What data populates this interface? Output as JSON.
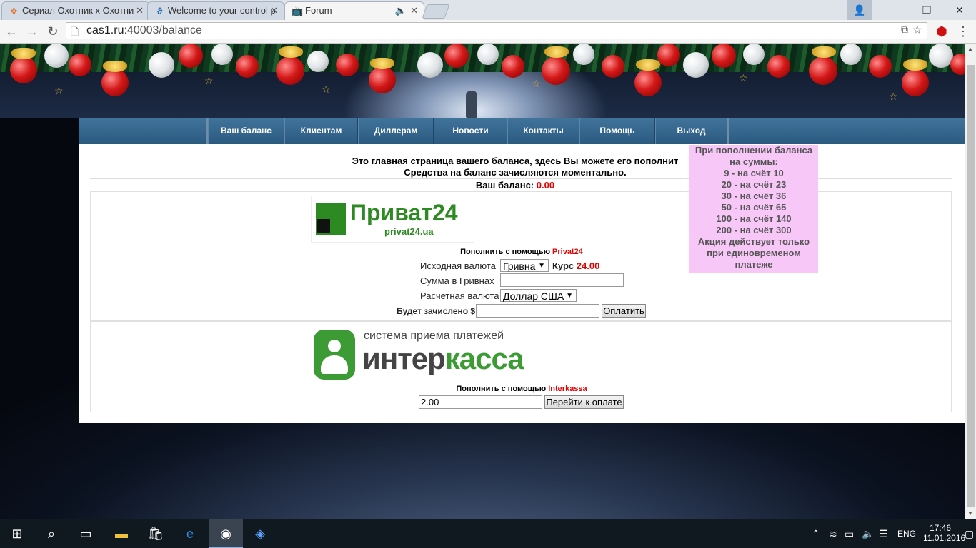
{
  "browser": {
    "tabs": [
      {
        "title": "Сериал Охотник х Охотни",
        "icon": "fox-icon"
      },
      {
        "title": "Welcome to your control p",
        "icon": "control-panel-icon"
      },
      {
        "title": "Forum",
        "icon": "tv-icon"
      }
    ],
    "url_host": "cas1.ru",
    "url_path": ":40003/balance"
  },
  "nav": {
    "items": [
      "Ваш баланс",
      "Клиентам",
      "Диллерам",
      "Новости",
      "Контакты",
      "Помощь",
      "Выход"
    ]
  },
  "intro": {
    "line1": "Это главная страница вашего баланса, здесь Вы можете его пополнит",
    "line2": "Средства на баланс зачисляются моментально.",
    "balance_label": "Ваш баланс:",
    "balance_value": "0.00"
  },
  "privat": {
    "logo_text": "Приват24",
    "logo_sub": "privat24.ua",
    "title_prefix": "Пополнить с помощью",
    "title_name": "Privat24",
    "src_currency_label": "Исходная валюта",
    "src_currency_value": "Гривна",
    "rate_label": "Курс",
    "rate_value": "24.00",
    "sum_label": "Сумма в Гривнах",
    "sum_value": "",
    "dst_currency_label": "Расчетная валюта",
    "dst_currency_value": "Доллар США",
    "credit_label": "Будет зачислено $",
    "credit_value": "",
    "pay_button": "Оплатить"
  },
  "interkassa": {
    "logo_top": "система приема платежей",
    "logo_main_a": "интер",
    "logo_main_b": "касса",
    "title_prefix": "Пополнить с помощью",
    "title_name": "Interkassa",
    "amount_value": "2.00",
    "go_button": "Перейти к оплате"
  },
  "promo": {
    "lines": [
      "При пополнении баланса",
      "на суммы:",
      "9 - на счёт 10",
      "20 - на счёт 23",
      "30 - на счёт 36",
      "50 - на счёт 65",
      "100 - на счёт 140",
      "200 - на счёт 300",
      "Акция действует только",
      "при единовременом",
      "платеже"
    ]
  },
  "taskbar": {
    "language": "ENG",
    "time": "17:46",
    "date": "11.01.2016"
  }
}
